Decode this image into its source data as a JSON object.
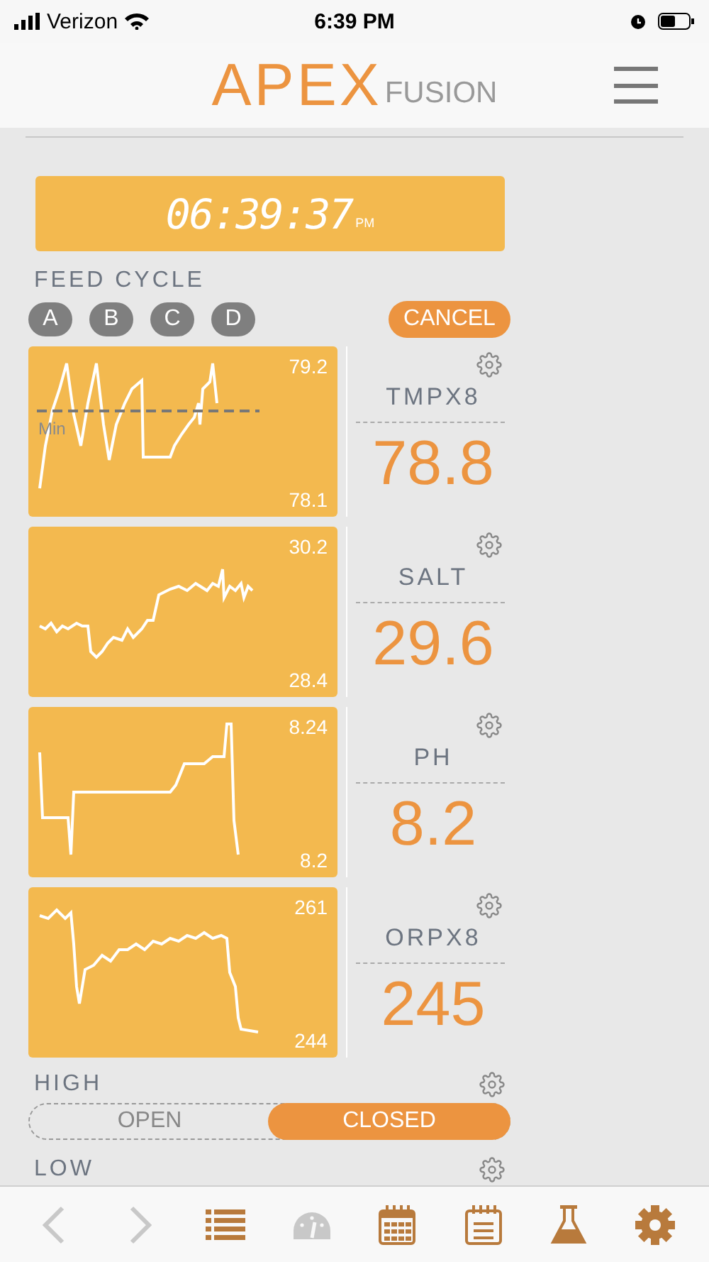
{
  "status_bar": {
    "carrier": "Verizon",
    "time": "6:39 PM"
  },
  "header": {
    "logo_main": "APEX",
    "logo_sub": "FUSION"
  },
  "clock": {
    "time": "06:39:37",
    "ampm": "PM"
  },
  "feed_cycle": {
    "label": "FEED CYCLE",
    "buttons": [
      "A",
      "B",
      "C",
      "D"
    ],
    "cancel": "CANCEL"
  },
  "probes": [
    {
      "name": "TMPX8",
      "value": "78.8",
      "high": "79.2",
      "low": "78.1",
      "min_label": "Min"
    },
    {
      "name": "SALT",
      "value": "29.6",
      "high": "30.2",
      "low": "28.4"
    },
    {
      "name": "PH",
      "value": "8.2",
      "high": "8.24",
      "low": "8.2"
    },
    {
      "name": "ORPX8",
      "value": "245",
      "high": "261",
      "low": "244"
    }
  ],
  "outputs": [
    {
      "name": "HIGH",
      "options": [
        {
          "label": "OPEN",
          "selected": false
        },
        {
          "label": "CLOSED",
          "selected": true
        }
      ]
    },
    {
      "name": "LOW"
    }
  ],
  "nav": [
    {
      "kind": "back",
      "disabled": true
    },
    {
      "kind": "forward",
      "disabled": true
    },
    {
      "kind": "list",
      "disabled": false
    },
    {
      "kind": "gauge",
      "disabled": true
    },
    {
      "kind": "calendar",
      "disabled": false
    },
    {
      "kind": "notes",
      "disabled": false
    },
    {
      "kind": "flask",
      "disabled": false
    },
    {
      "kind": "gear",
      "disabled": false
    }
  ]
}
